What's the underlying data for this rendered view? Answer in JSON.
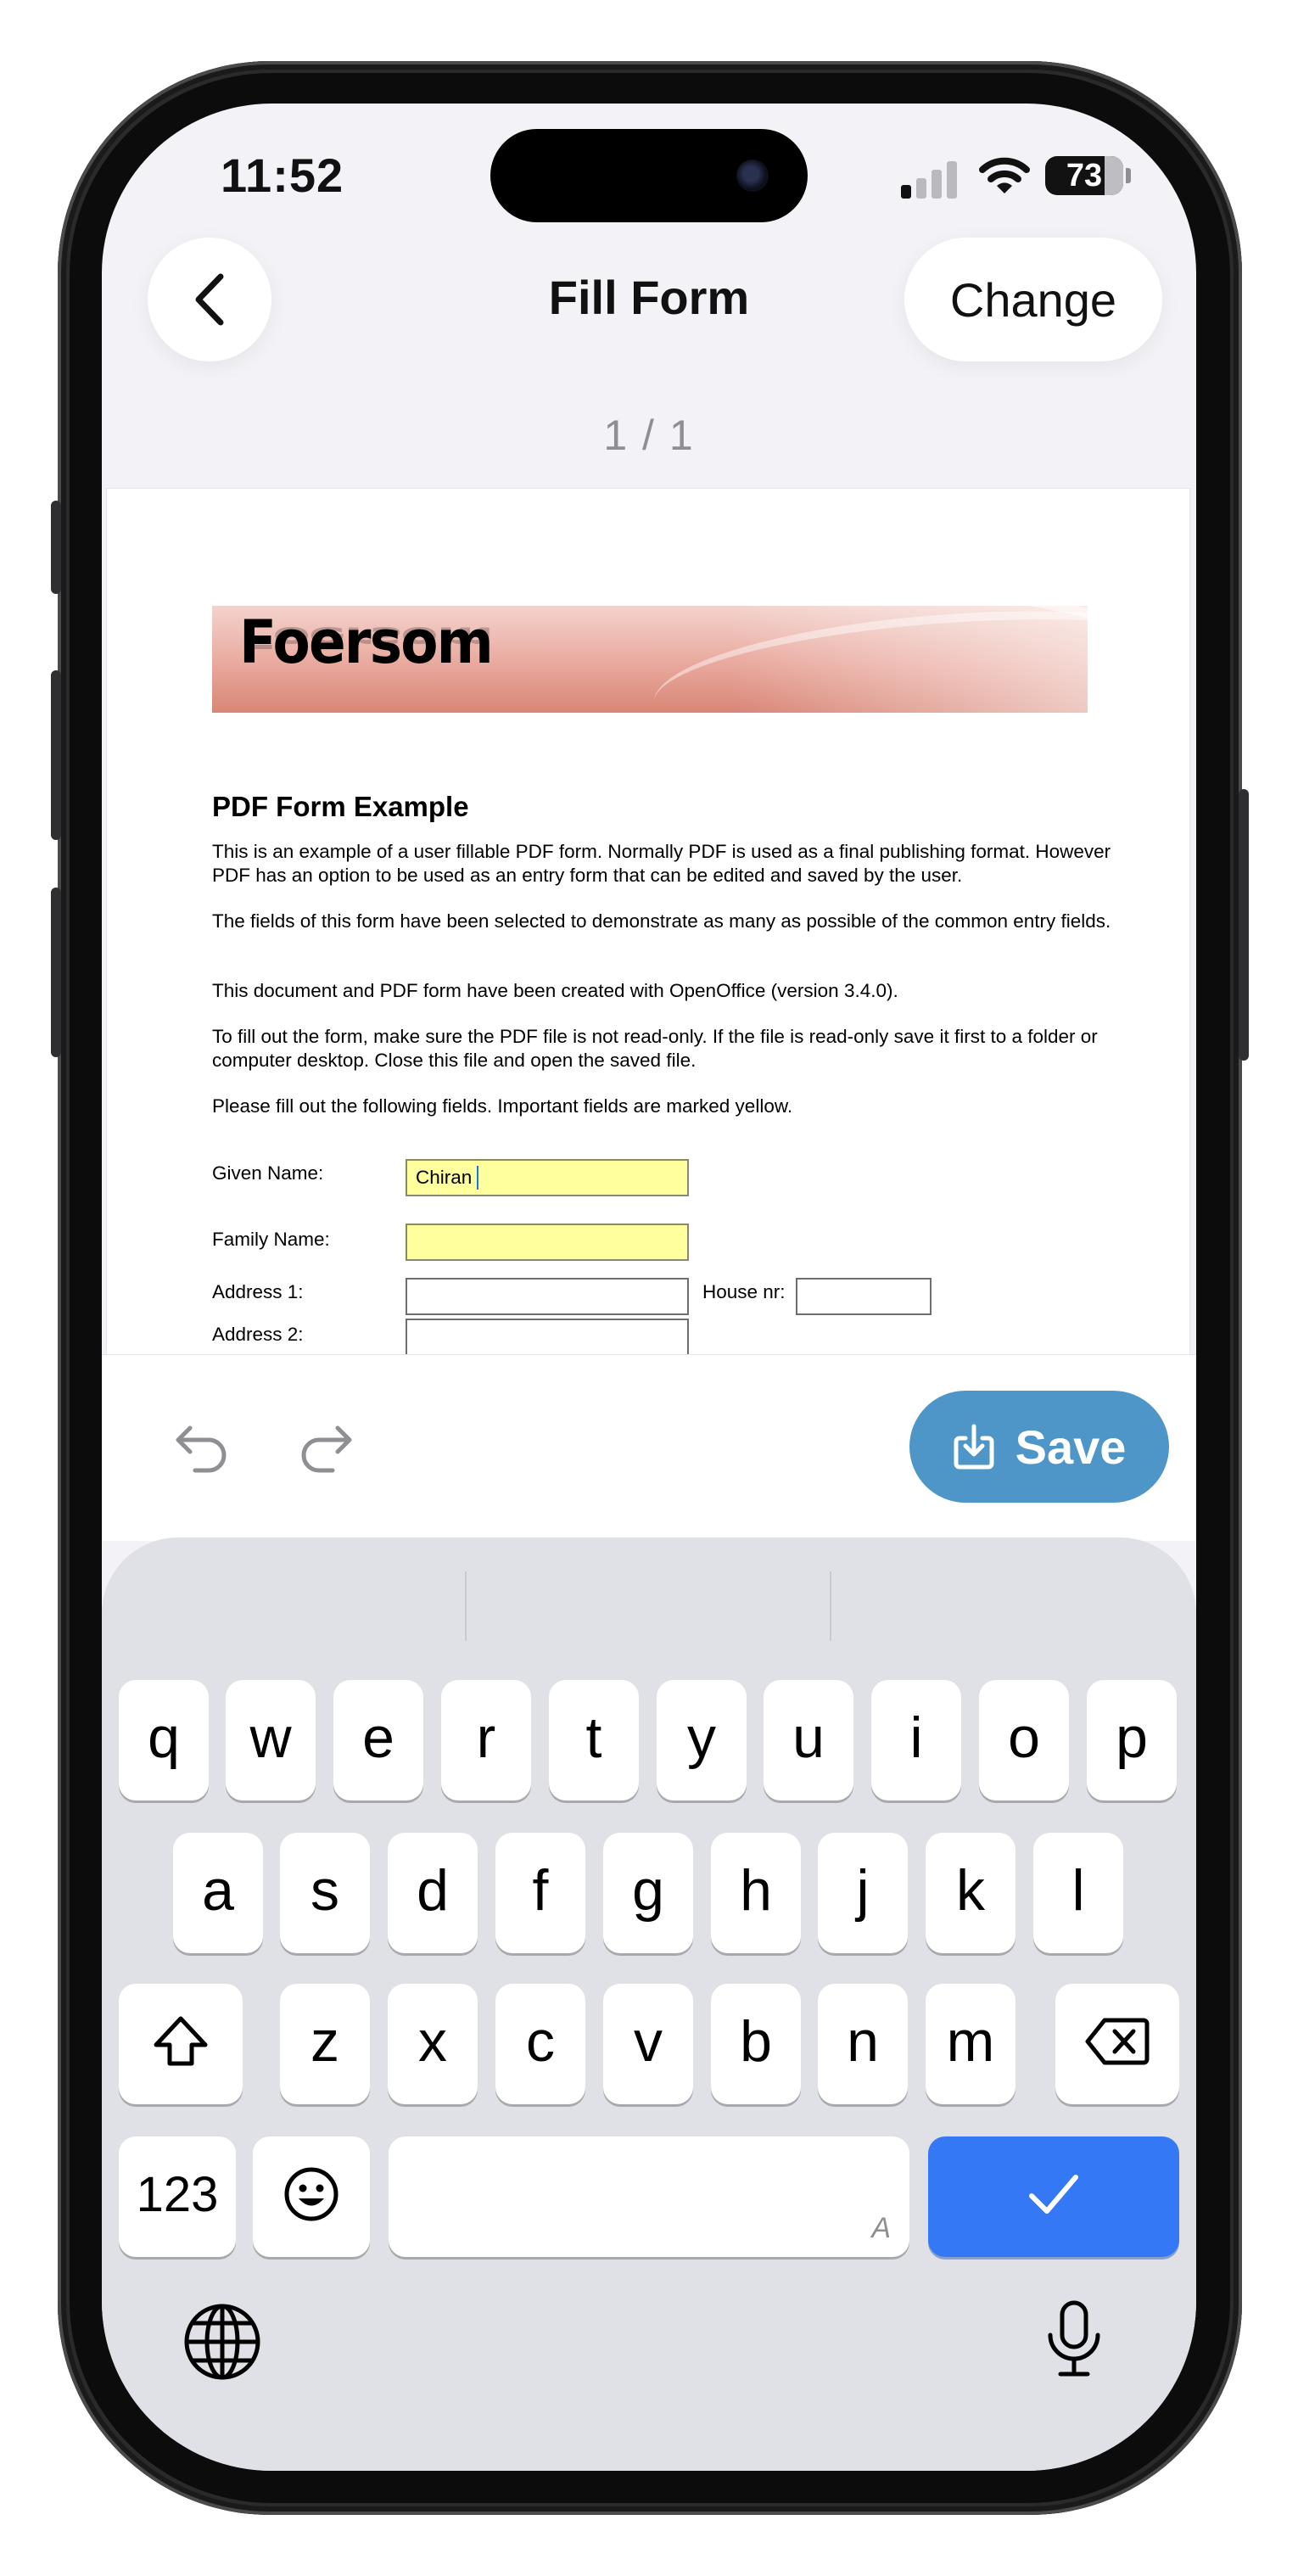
{
  "status_bar": {
    "time": "11:52",
    "battery": "73"
  },
  "nav": {
    "title": "Fill Form",
    "change_label": "Change"
  },
  "page_indicator": "1 / 1",
  "pdf": {
    "logo": "Foersom",
    "heading": "PDF Form Example",
    "paragraphs": [
      "This is an example of a user fillable PDF form. Normally PDF is used as a final publishing format. However PDF has an option to be used as an entry form that can be edited and saved by the user.",
      "The fields of this form have been selected to demonstrate as many as possible of the common entry fields.",
      "This document and PDF form have been created with OpenOffice (version 3.4.0).",
      "To fill out the form, make sure the PDF file is not read-only. If the file is read-only save it first to a folder or computer desktop. Close this file and open the saved file.",
      "Please fill out the following fields. Important fields are marked yellow."
    ],
    "form": {
      "given_name_label": "Given Name:",
      "given_name_value": "Chiran",
      "family_name_label": "Family Name:",
      "family_name_value": "",
      "address1_label": "Address 1:",
      "address1_value": "",
      "house_nr_label": "House nr:",
      "house_nr_value": "",
      "address2_label": "Address 2:",
      "address2_value": ""
    }
  },
  "toolbar": {
    "save_label": "Save"
  },
  "keyboard": {
    "row1": [
      "q",
      "w",
      "e",
      "r",
      "t",
      "y",
      "u",
      "i",
      "o",
      "p"
    ],
    "row2": [
      "a",
      "s",
      "d",
      "f",
      "g",
      "h",
      "j",
      "k",
      "l"
    ],
    "row3": [
      "z",
      "x",
      "c",
      "v",
      "b",
      "n",
      "m"
    ],
    "numbers_key": "123",
    "space_hint": "A",
    "icons": {
      "shift": "shift-icon",
      "delete": "delete-icon",
      "emoji": "emoji-icon",
      "confirm": "checkmark-icon",
      "globe": "globe-icon",
      "mic": "microphone-icon"
    }
  },
  "colors": {
    "save_button": "#4e96c7",
    "confirm_key": "#3478f6",
    "required_field": "#ffff9e"
  }
}
